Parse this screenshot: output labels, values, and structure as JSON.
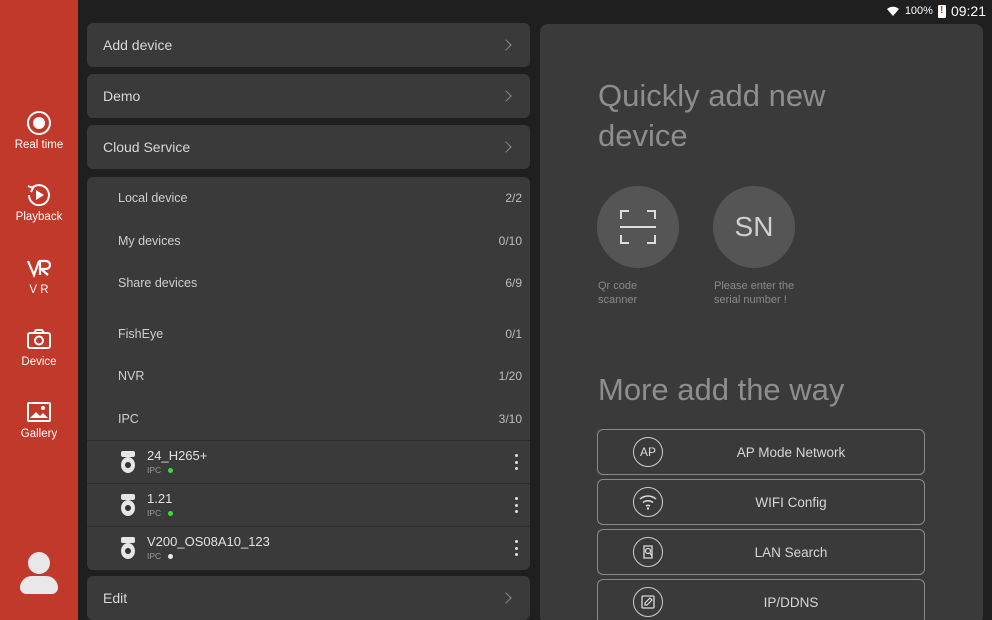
{
  "status": {
    "battery": "100%",
    "time": "09:21"
  },
  "sidebar": {
    "items": [
      {
        "label": "Real time",
        "icon": "play-circle-icon"
      },
      {
        "label": "Playback",
        "icon": "replay-icon"
      },
      {
        "label": "V R",
        "icon": "vr-icon"
      },
      {
        "label": "Device",
        "icon": "camera-icon",
        "active": true
      },
      {
        "label": "Gallery",
        "icon": "image-icon"
      }
    ],
    "avatar": "user-avatar-icon"
  },
  "menu": {
    "add_device": "Add device",
    "demo": "Demo",
    "cloud_service": "Cloud Service",
    "edit": "Edit"
  },
  "groups": [
    {
      "label": "Local device",
      "count": "2/2"
    },
    {
      "label": "My devices",
      "count": "0/10"
    },
    {
      "label": "Share devices",
      "count": "6/9"
    },
    {
      "label": "FishEye",
      "count": "0/1"
    },
    {
      "label": "NVR",
      "count": "1/20"
    },
    {
      "label": "IPC",
      "count": "3/10"
    }
  ],
  "devices": [
    {
      "name": "24_H265+",
      "type": "IPC",
      "status_color": "#3ddc3d"
    },
    {
      "name": "1.21",
      "type": "IPC",
      "status_color": "#3ddc3d"
    },
    {
      "name": "V200_OS08A10_123",
      "type": "IPC",
      "status_color": "#e8e8e8"
    }
  ],
  "right": {
    "quick_title": "Quickly add new device",
    "qr_caption": "Qr code scanner",
    "sn_label": "SN",
    "sn_caption": "Please enter the serial number !",
    "more_title": "More add the way",
    "ways": [
      {
        "label": "AP Mode Network",
        "icon_text": "AP",
        "icon": "ap-icon"
      },
      {
        "label": "WIFI Config",
        "icon_text": "",
        "icon": "wifi-icon"
      },
      {
        "label": "LAN Search",
        "icon_text": "",
        "icon": "lan-search-icon"
      },
      {
        "label": "IP/DDNS",
        "icon_text": "",
        "icon": "edit-icon"
      }
    ]
  },
  "colors": {
    "sidebar": "#c0392b",
    "panel": "#3a3a3a",
    "background": "#1f1f1f",
    "online": "#3ddc3d"
  }
}
